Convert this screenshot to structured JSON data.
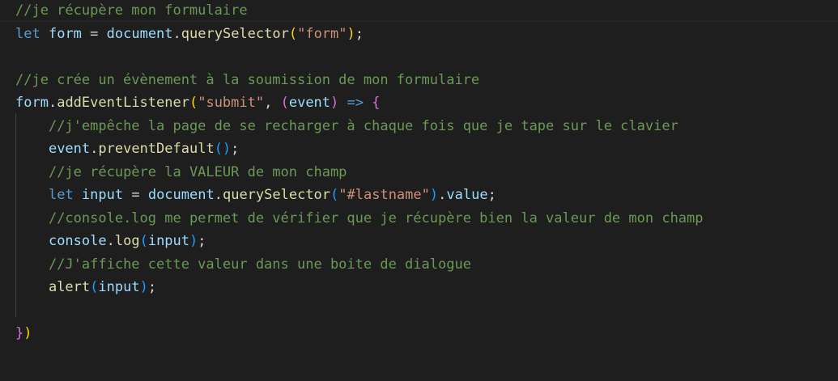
{
  "theme": {
    "background": "#1e1e1e",
    "comment": "#6a9955",
    "keyword": "#569cd6",
    "variable": "#9cdcfe",
    "function": "#dcdcaa",
    "string": "#ce9178",
    "punctuation": "#d4d4d4",
    "bracket_level_1": "#ffd700",
    "bracket_level_2": "#da70d6",
    "bracket_level_3": "#179fff"
  },
  "code": {
    "lines": [
      [
        {
          "t": "comment",
          "v": "//je récupère mon formulaire"
        }
      ],
      [
        {
          "t": "keyword",
          "v": "let"
        },
        {
          "t": "punct",
          "v": " "
        },
        {
          "t": "variable",
          "v": "form"
        },
        {
          "t": "punct",
          "v": " = "
        },
        {
          "t": "variable",
          "v": "document"
        },
        {
          "t": "punct",
          "v": "."
        },
        {
          "t": "function",
          "v": "querySelector"
        },
        {
          "t": "bracket-1",
          "v": "("
        },
        {
          "t": "string",
          "v": "\"form\""
        },
        {
          "t": "bracket-1",
          "v": ")"
        },
        {
          "t": "punct",
          "v": ";"
        }
      ],
      [],
      [
        {
          "t": "comment",
          "v": "//je crée un évènement à la soumission de mon formulaire"
        }
      ],
      [
        {
          "t": "variable",
          "v": "form"
        },
        {
          "t": "punct",
          "v": "."
        },
        {
          "t": "function",
          "v": "addEventListener"
        },
        {
          "t": "bracket-1",
          "v": "("
        },
        {
          "t": "string",
          "v": "\"submit\""
        },
        {
          "t": "punct",
          "v": ", "
        },
        {
          "t": "bracket-2",
          "v": "("
        },
        {
          "t": "variable",
          "v": "event"
        },
        {
          "t": "bracket-2",
          "v": ")"
        },
        {
          "t": "punct",
          "v": " "
        },
        {
          "t": "keyword",
          "v": "=>"
        },
        {
          "t": "punct",
          "v": " "
        },
        {
          "t": "bracket-2",
          "v": "{"
        }
      ],
      [
        {
          "t": "punct",
          "v": "    "
        },
        {
          "t": "comment",
          "v": "//j'empêche la page de se recharger à chaque fois que je tape sur le clavier"
        }
      ],
      [
        {
          "t": "punct",
          "v": "    "
        },
        {
          "t": "variable",
          "v": "event"
        },
        {
          "t": "punct",
          "v": "."
        },
        {
          "t": "function",
          "v": "preventDefault"
        },
        {
          "t": "bracket-3",
          "v": "()"
        },
        {
          "t": "punct",
          "v": ";"
        }
      ],
      [
        {
          "t": "punct",
          "v": "    "
        },
        {
          "t": "comment",
          "v": "//je récupère la VALEUR de mon champ"
        }
      ],
      [
        {
          "t": "punct",
          "v": "    "
        },
        {
          "t": "keyword",
          "v": "let"
        },
        {
          "t": "punct",
          "v": " "
        },
        {
          "t": "variable",
          "v": "input"
        },
        {
          "t": "punct",
          "v": " = "
        },
        {
          "t": "variable",
          "v": "document"
        },
        {
          "t": "punct",
          "v": "."
        },
        {
          "t": "function",
          "v": "querySelector"
        },
        {
          "t": "bracket-3",
          "v": "("
        },
        {
          "t": "string",
          "v": "\"#lastname\""
        },
        {
          "t": "bracket-3",
          "v": ")"
        },
        {
          "t": "punct",
          "v": "."
        },
        {
          "t": "variable",
          "v": "value"
        },
        {
          "t": "punct",
          "v": ";"
        }
      ],
      [
        {
          "t": "punct",
          "v": "    "
        },
        {
          "t": "comment",
          "v": "//console.log me permet de vérifier que je récupère bien la valeur de mon champ"
        }
      ],
      [
        {
          "t": "punct",
          "v": "    "
        },
        {
          "t": "variable",
          "v": "console"
        },
        {
          "t": "punct",
          "v": "."
        },
        {
          "t": "function",
          "v": "log"
        },
        {
          "t": "bracket-3",
          "v": "("
        },
        {
          "t": "variable",
          "v": "input"
        },
        {
          "t": "bracket-3",
          "v": ")"
        },
        {
          "t": "punct",
          "v": ";"
        }
      ],
      [
        {
          "t": "punct",
          "v": "    "
        },
        {
          "t": "comment",
          "v": "//J'affiche cette valeur dans une boite de dialogue"
        }
      ],
      [
        {
          "t": "punct",
          "v": "    "
        },
        {
          "t": "function",
          "v": "alert"
        },
        {
          "t": "bracket-3",
          "v": "("
        },
        {
          "t": "variable",
          "v": "input"
        },
        {
          "t": "bracket-3",
          "v": ")"
        },
        {
          "t": "punct",
          "v": ";"
        }
      ],
      [],
      [
        {
          "t": "bracket-2",
          "v": "}"
        },
        {
          "t": "bracket-1",
          "v": ")"
        }
      ]
    ]
  }
}
